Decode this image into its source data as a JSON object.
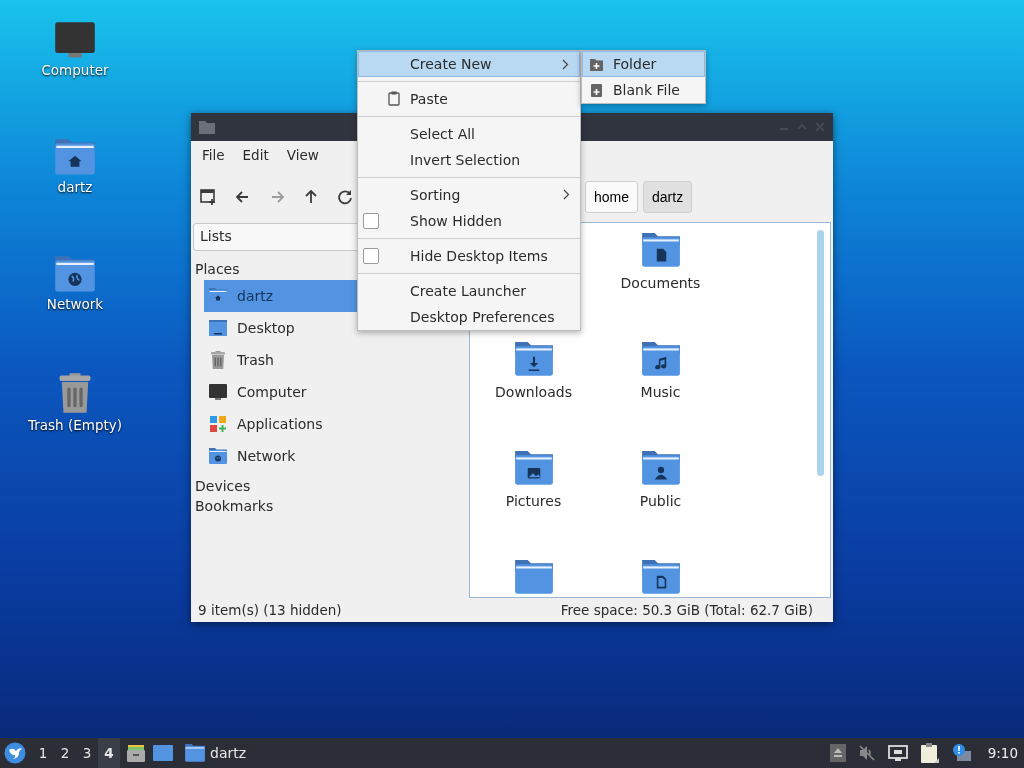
{
  "desktop_icons": [
    {
      "label": "Computer",
      "kind": "computer"
    },
    {
      "label": "dartz",
      "kind": "home"
    },
    {
      "label": "Network",
      "kind": "network"
    },
    {
      "label": "Trash (Empty)",
      "kind": "trash"
    }
  ],
  "window": {
    "menu": [
      {
        "label": "File"
      },
      {
        "label": "Edit"
      },
      {
        "label": "View"
      }
    ],
    "toolbar": [
      {
        "kind": "new-tab",
        "disabled": false
      },
      {
        "kind": "back",
        "disabled": false
      },
      {
        "kind": "forward",
        "disabled": true
      },
      {
        "kind": "up",
        "disabled": false
      },
      {
        "kind": "reload",
        "disabled": false
      }
    ],
    "path": [
      {
        "label": "home",
        "selected": false
      },
      {
        "label": "dartz",
        "selected": true
      }
    ],
    "side_panel": {
      "mode": "Lists",
      "sections": [
        {
          "label": "Places",
          "items": [
            {
              "label": "dartz",
              "kind": "home",
              "selected": true
            },
            {
              "label": "Desktop",
              "kind": "desktop",
              "selected": false
            },
            {
              "label": "Trash",
              "kind": "trash",
              "selected": false
            },
            {
              "label": "Computer",
              "kind": "computer",
              "selected": false
            },
            {
              "label": "Applications",
              "kind": "applications",
              "selected": false
            },
            {
              "label": "Network",
              "kind": "network",
              "selected": false
            }
          ]
        },
        {
          "label": "Devices"
        },
        {
          "label": "Bookmarks"
        }
      ]
    },
    "files": [
      {
        "label": "Documents",
        "kind": "documents"
      },
      {
        "label": "Downloads",
        "kind": "downloads"
      },
      {
        "label": "Music",
        "kind": "music"
      },
      {
        "label": "Pictures",
        "kind": "pictures"
      },
      {
        "label": "Public",
        "kind": "public"
      },
      {
        "kind": "plain"
      },
      {
        "kind": "templates"
      }
    ],
    "status_left": "9 item(s) (13 hidden)",
    "status_right": "Free space: 50.3 GiB (Total: 62.7 GiB)"
  },
  "context_menu": {
    "items": [
      {
        "kind": "submenu",
        "label": "Create New",
        "selected": true
      },
      {
        "kind": "separator"
      },
      {
        "kind": "icon",
        "label": "Paste",
        "selected": false
      },
      {
        "kind": "separator"
      },
      {
        "kind": "item",
        "label": "Select All",
        "selected": false
      },
      {
        "kind": "item",
        "label": "Invert Selection",
        "selected": false
      },
      {
        "kind": "separator"
      },
      {
        "kind": "submenu",
        "label": "Sorting",
        "selected": false
      },
      {
        "kind": "check",
        "label": "Show Hidden",
        "checked": false,
        "selected": false
      },
      {
        "kind": "separator"
      },
      {
        "kind": "check",
        "label": "Hide Desktop Items",
        "checked": false,
        "selected": false
      },
      {
        "kind": "separator"
      },
      {
        "kind": "item",
        "label": "Create Launcher",
        "selected": false
      },
      {
        "kind": "item",
        "label": "Desktop Preferences",
        "selected": false
      }
    ]
  },
  "submenu": {
    "items": [
      {
        "kind": "folder",
        "label": "Folder",
        "selected": true
      },
      {
        "kind": "file",
        "label": "Blank File",
        "selected": false
      }
    ]
  },
  "taskbar": {
    "workspaces": [
      {
        "label": "1",
        "selected": false
      },
      {
        "label": "2",
        "selected": false
      },
      {
        "label": "3",
        "selected": false
      },
      {
        "label": "4",
        "selected": true
      }
    ],
    "tasks": [
      {
        "label": "dartz"
      }
    ],
    "clock": "9:10"
  }
}
